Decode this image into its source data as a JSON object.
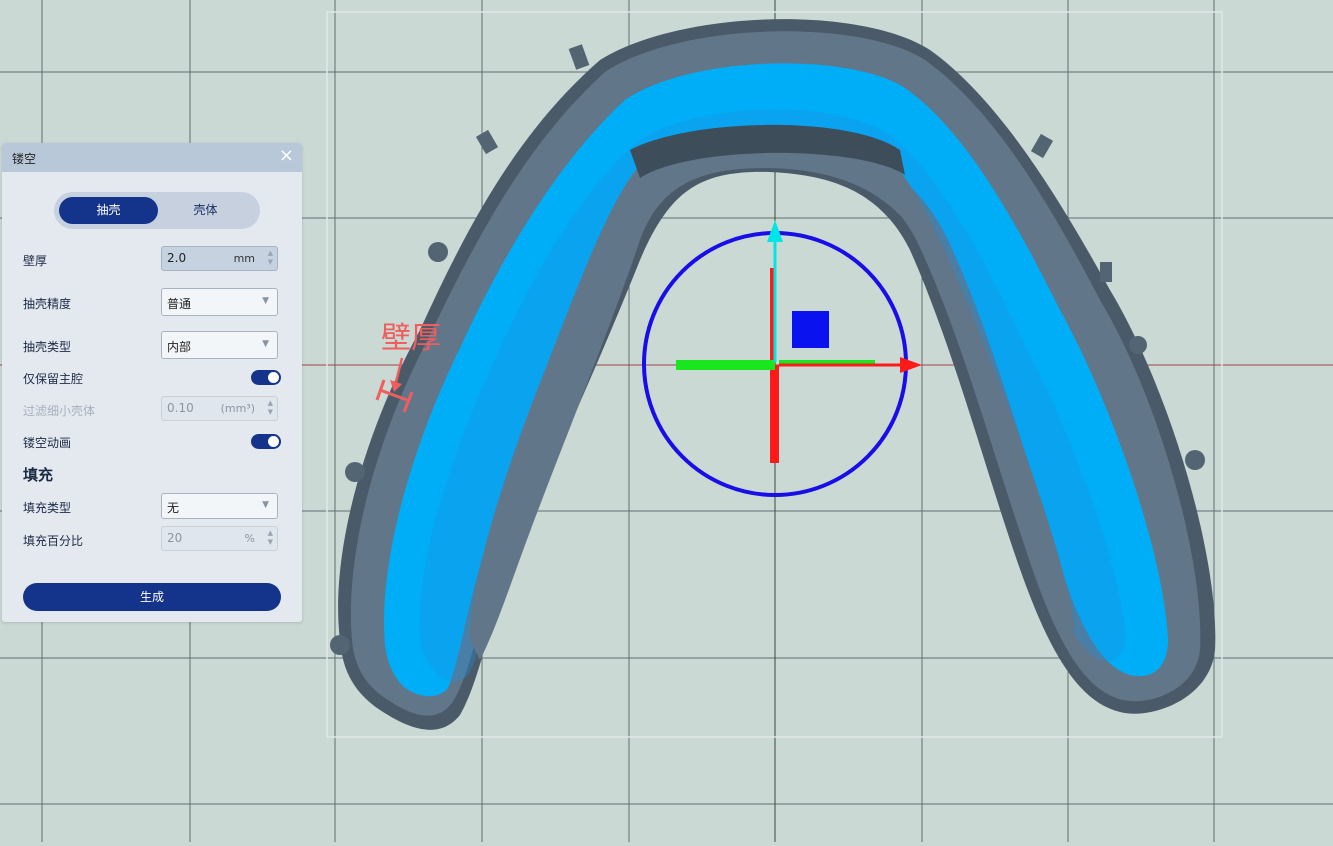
{
  "viewport": {
    "annotation_label": "壁厚",
    "gizmo_colors": {
      "x_axis": "#ff1a1a",
      "y_axis": "#19e61e",
      "z_axis": "#00e5e5",
      "ring": "#1a0ee6",
      "plane_handle": "#0b12f0"
    }
  },
  "panel": {
    "title": "镂空",
    "close_icon": "×",
    "tabs": [
      {
        "label": "抽壳",
        "active": true
      },
      {
        "label": "壳体",
        "active": false
      }
    ],
    "wall_thickness": {
      "label": "壁厚",
      "value": "2.0",
      "unit": "mm"
    },
    "shell_precision": {
      "label": "抽壳精度",
      "value": "普通"
    },
    "shell_type": {
      "label": "抽壳类型",
      "value": "内部"
    },
    "keep_main_cavity": {
      "label": "仅保留主腔",
      "on": true
    },
    "filter_small_shell": {
      "label": "过滤细小壳体",
      "value": "0.10",
      "unit": "(mm³)",
      "disabled": true
    },
    "hollow_animation": {
      "label": "镂空动画",
      "on": true
    },
    "fill_section": {
      "heading": "填充"
    },
    "fill_type": {
      "label": "填充类型",
      "value": "无"
    },
    "fill_percent": {
      "label": "填充百分比",
      "value": "20",
      "unit": "%",
      "disabled": true
    },
    "generate_button": "生成"
  }
}
